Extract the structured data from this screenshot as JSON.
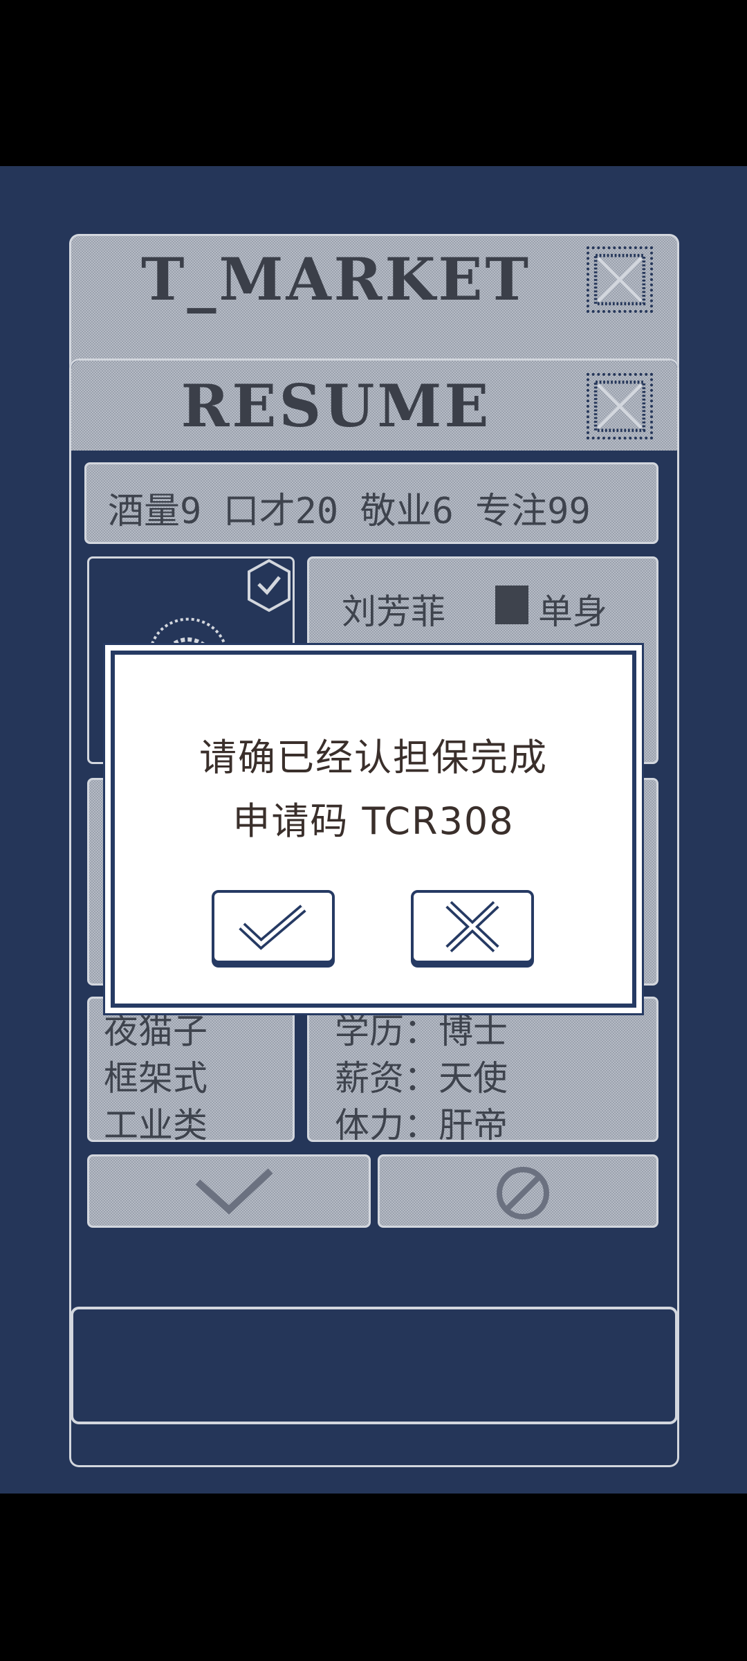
{
  "market_window": {
    "title": "T_MARKET"
  },
  "resume_window": {
    "title": "RESUME",
    "stats_line": "酒量9  口才20  敬业6  专注99",
    "name_text": "刘芳菲",
    "status_text": "单身",
    "traits": [
      "夜猫子",
      "框架式",
      "工业类"
    ],
    "details": [
      "学历：博士",
      "薪资：天使",
      "体力：肝帝"
    ]
  },
  "dialog": {
    "line1": "请确已经认担保完成",
    "line2": "申请码 TCR308",
    "confirm_icon": "check-icon",
    "cancel_icon": "x-icon"
  },
  "colors": {
    "background": "#253659",
    "dialog_border": "#263a63",
    "dialog_text": "#3a2f2b"
  }
}
